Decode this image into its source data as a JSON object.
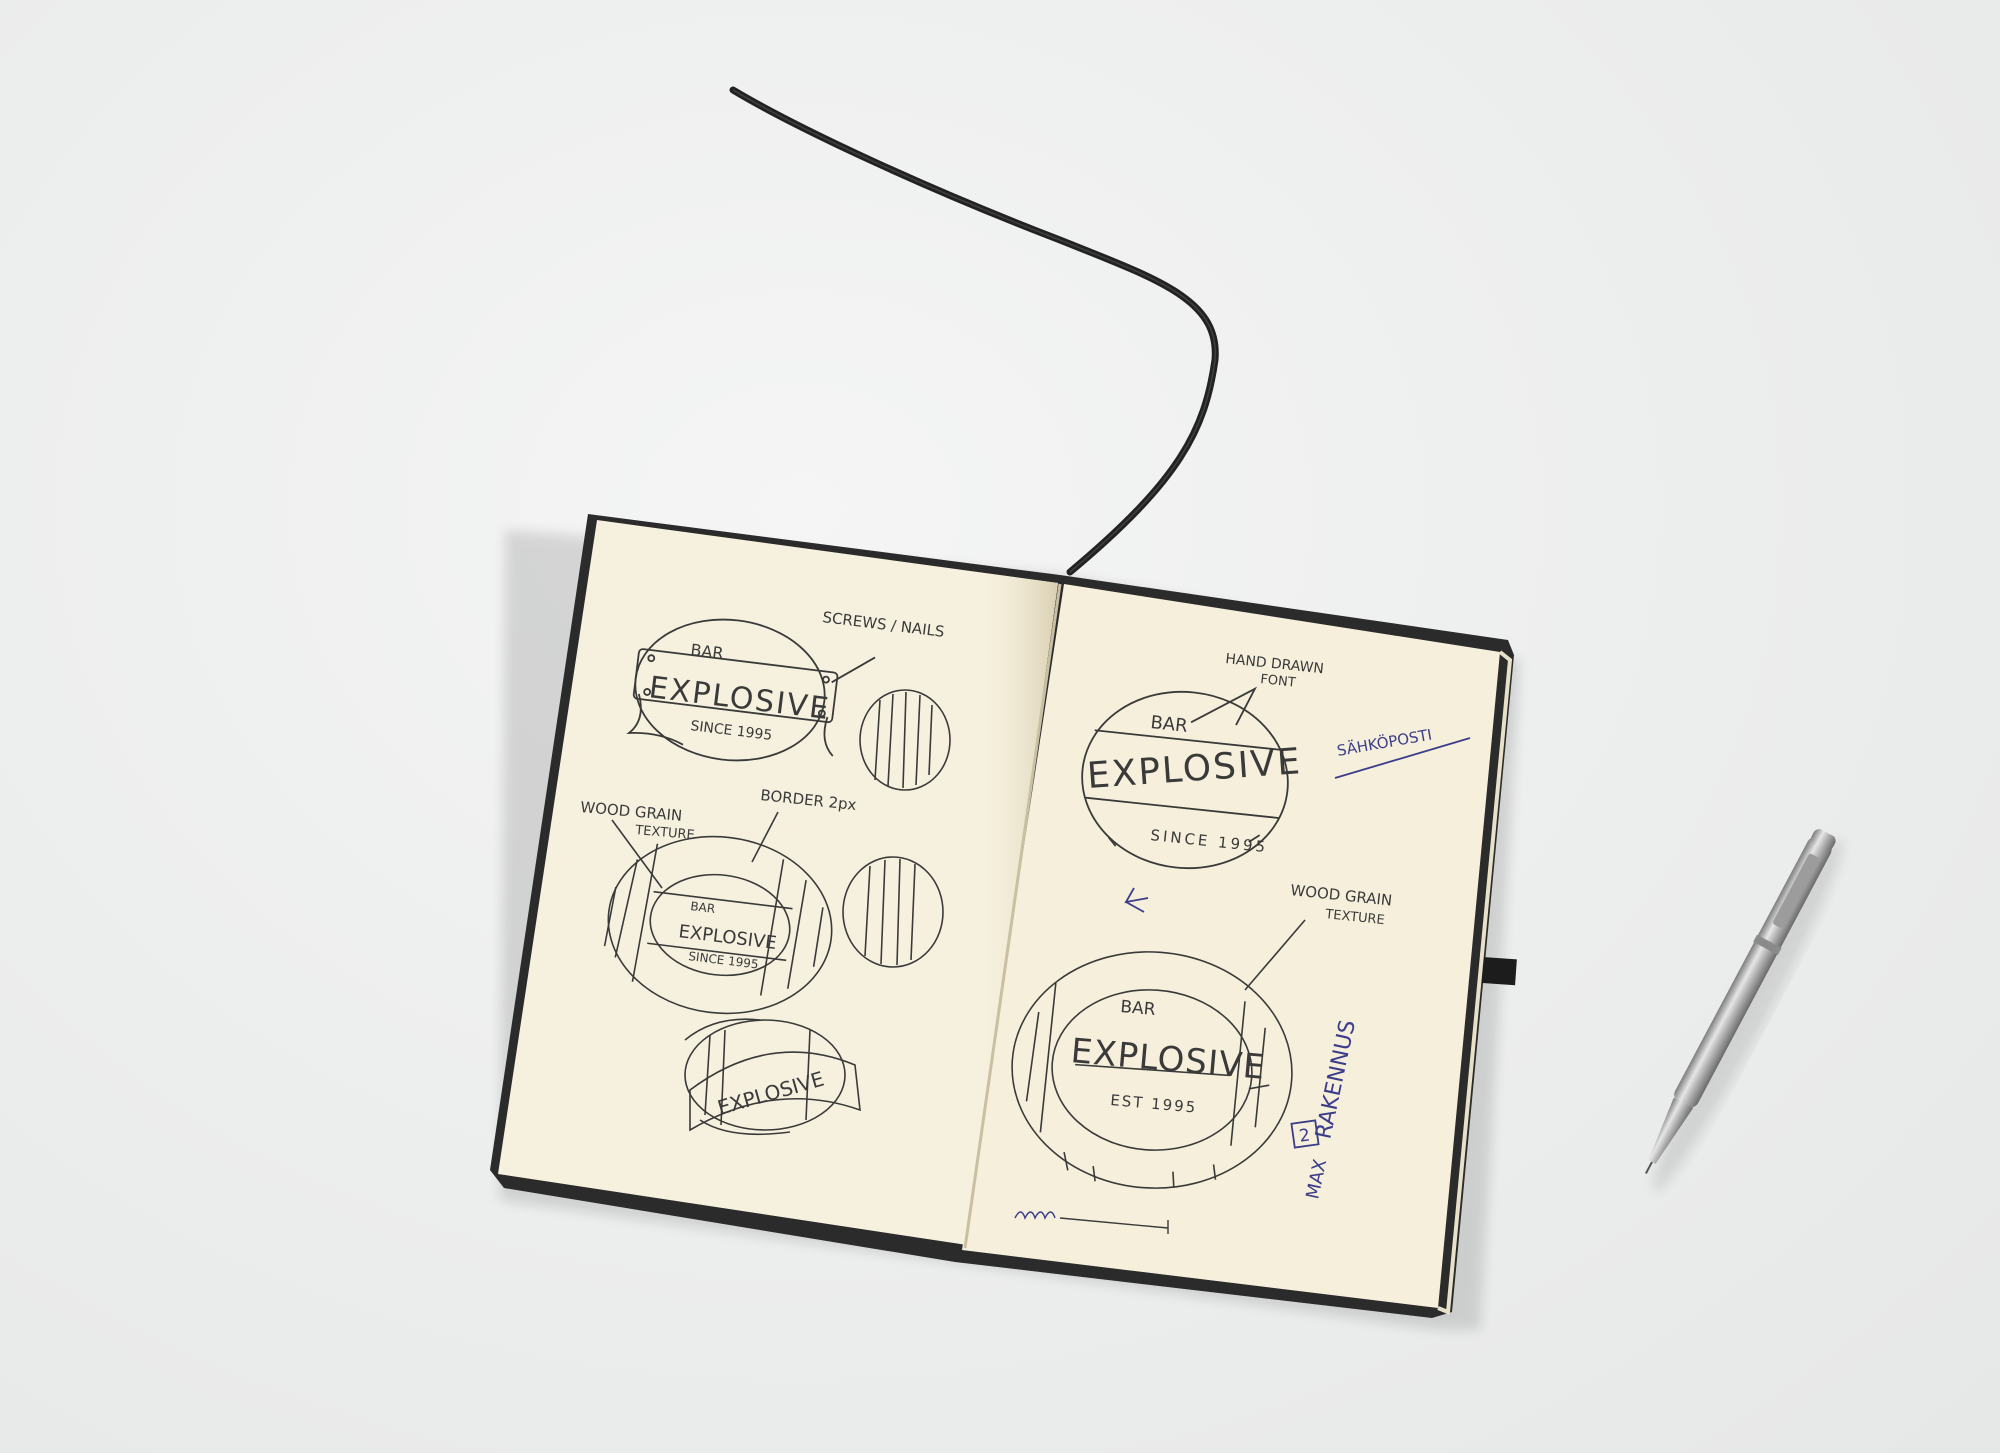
{
  "photo": {
    "background_color": "#ececec",
    "cover_color": "#2b2b2b",
    "page_color": "#f5efdc",
    "ink_color": "#3a3a3a",
    "blue_ink_color": "#3b3d8a",
    "pen_color": "#b8b8b8"
  },
  "left_page": {
    "sketch1": {
      "top": "BAR",
      "main": "EXPLOSIVE",
      "bottom": "SINCE 1995",
      "note": "SCREWS / NAILS"
    },
    "sketch2": {
      "note1": "WOOD GRAIN",
      "note1b": "TEXTURE",
      "note2": "BORDER 2px",
      "top": "BAR",
      "main": "EXPLOSIVE",
      "bottom": "SINCE 1995"
    },
    "sketch3": {
      "main": "EXPLOSIVE"
    }
  },
  "right_page": {
    "sketch1": {
      "note": "HAND DRAWN",
      "note_b": "FONT",
      "top": "BAR",
      "main": "EXPLOSIVE",
      "bottom": "SINCE 1995"
    },
    "blue_note1": "SÄHKÖPOSTI",
    "sketch2": {
      "note": "WOOD GRAIN",
      "note_b": "TEXTURE",
      "top": "BAR",
      "main": "EXPLOSIVE",
      "bottom": "EST 1995"
    },
    "blue_note2": "RAKENNUS",
    "blue_note3": "MAX",
    "box_number": "2"
  }
}
